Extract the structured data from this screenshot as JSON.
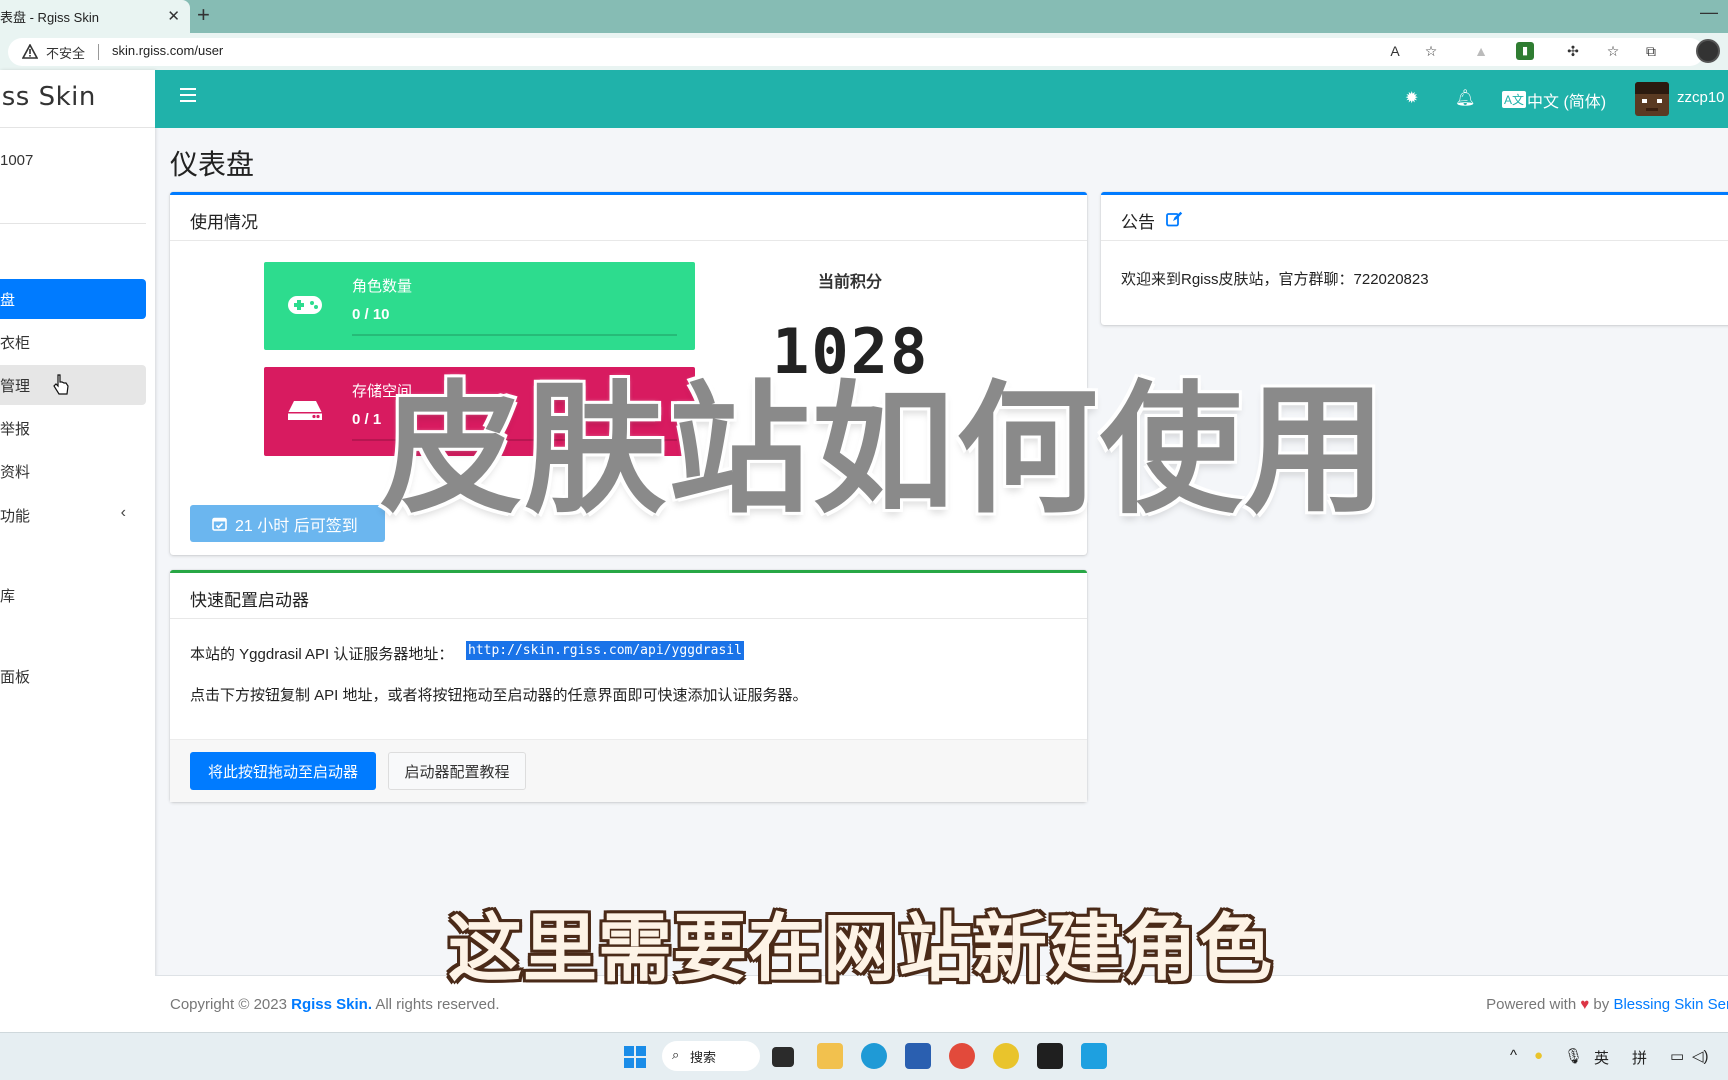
{
  "browser": {
    "tab_title": "表盘 - Rgiss Skin",
    "tab_close": "✕",
    "new_tab": "+",
    "minimize": "—",
    "security_label": "不安全",
    "url": "skin.rgiss.com/user"
  },
  "sidebar": {
    "brand": "iss Skin",
    "user_id": "1007",
    "items": [
      {
        "label": "盘",
        "active": true
      },
      {
        "label": "衣柜"
      },
      {
        "label": "管理",
        "hover": true
      },
      {
        "label": "举报"
      },
      {
        "label": "资料"
      },
      {
        "label": "功能",
        "has_submenu": true
      },
      {
        "label": "库"
      },
      {
        "label": "面板"
      }
    ]
  },
  "topnav": {
    "language": "中文 (简体)",
    "username": "zzcp10"
  },
  "page": {
    "title": "仪表盘"
  },
  "usage_card": {
    "title": "使用情况",
    "roles": {
      "label": "角色数量",
      "value": "0 / 10",
      "color": "#2ddc8e"
    },
    "storage": {
      "label": "存储空间",
      "value": "0 / 1",
      "color": "#d81b60"
    },
    "score_title": "当前积分",
    "score_value": "1028",
    "checkin_label": "21 小时 后可签到"
  },
  "notice_card": {
    "title": "公告",
    "text": "欢迎来到Rgiss皮肤站，官方群聊：722020823"
  },
  "launcher_card": {
    "title": "快速配置启动器",
    "api_label": "本站的 Yggdrasil API 认证服务器地址：",
    "api_url": "http://skin.rgiss.com/api/yggdrasil",
    "description": "点击下方按钮复制 API 地址，或者将按钮拖动至启动器的任意界面即可快速添加认证服务器。",
    "drag_button": "将此按钮拖动至启动器",
    "tutorial_button": "启动器配置教程"
  },
  "footer": {
    "copyright_prefix": "Copyright © 2023 ",
    "site_name": "Rgiss Skin.",
    "copyright_suffix": " All rights reserved.",
    "powered_prefix": "Powered with ",
    "powered_by": " by ",
    "powered_link": "Blessing Skin Ser"
  },
  "overlay": {
    "title": "皮肤站如何使用",
    "subtitle": "这里需要在网站新建角色"
  },
  "taskbar": {
    "search": "搜索",
    "ime_lang": "英",
    "ime_mode": "拼"
  },
  "colors": {
    "teal": "#20b2aa",
    "primary": "#007bff",
    "success": "#28a745"
  }
}
